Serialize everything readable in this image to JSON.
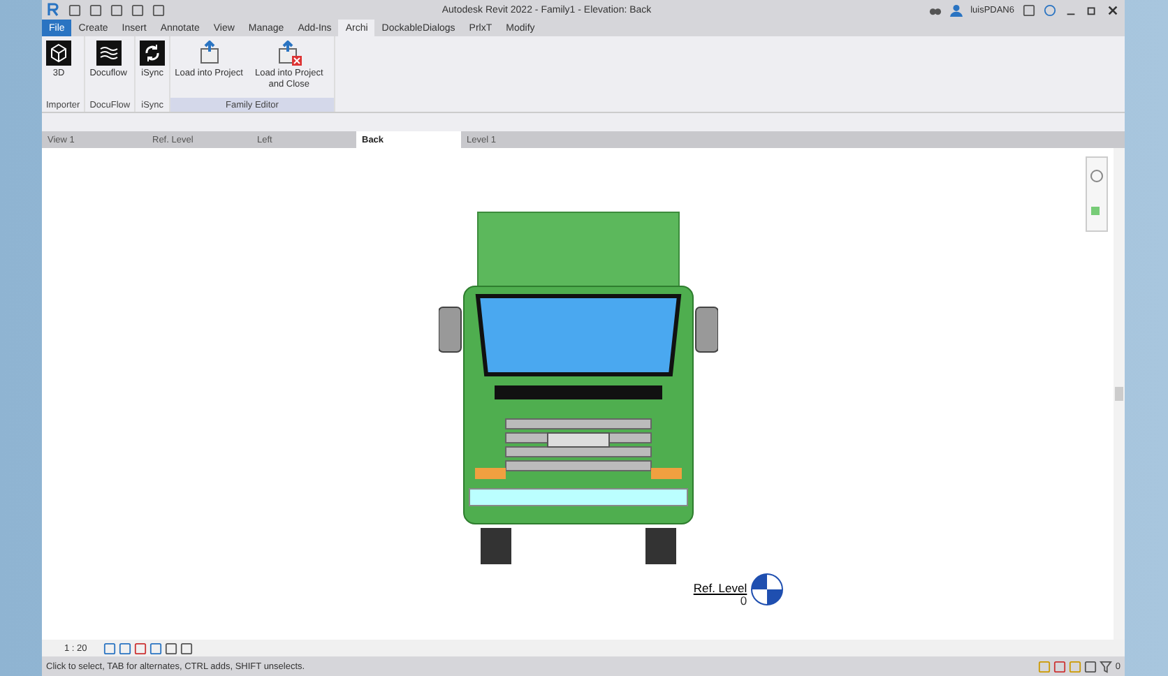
{
  "window": {
    "title": "Autodesk Revit 2022 - Family1 - Elevation: Back",
    "user": "luisPDAN6"
  },
  "ribbon_tabs": [
    {
      "label": "File",
      "kind": "file",
      "selected": false
    },
    {
      "label": "Create",
      "kind": "tab",
      "selected": false
    },
    {
      "label": "Insert",
      "kind": "tab",
      "selected": false
    },
    {
      "label": "Annotate",
      "kind": "tab",
      "selected": false
    },
    {
      "label": "View",
      "kind": "tab",
      "selected": false
    },
    {
      "label": "Manage",
      "kind": "tab",
      "selected": false
    },
    {
      "label": "Add-Ins",
      "kind": "tab",
      "selected": false
    },
    {
      "label": "Archi",
      "kind": "tab",
      "selected": true
    },
    {
      "label": "DockableDialogs",
      "kind": "tab",
      "selected": false
    },
    {
      "label": "PrlxT",
      "kind": "tab",
      "selected": false
    },
    {
      "label": "Modify",
      "kind": "tab",
      "selected": false
    }
  ],
  "panels": [
    {
      "title": "Importer",
      "highlighted": false,
      "buttons": [
        {
          "label": "3D",
          "kind": "cube"
        }
      ]
    },
    {
      "title": "DocuFlow",
      "highlighted": false,
      "buttons": [
        {
          "label": "Docuflow",
          "kind": "waves"
        }
      ]
    },
    {
      "title": "iSync",
      "highlighted": false,
      "buttons": [
        {
          "label": "iSync",
          "kind": "sync"
        }
      ]
    },
    {
      "title": "Family Editor",
      "highlighted": true,
      "buttons": [
        {
          "label": "Load into Project",
          "kind": "load"
        },
        {
          "label": "Load into Project and Close",
          "kind": "loadclose"
        }
      ]
    }
  ],
  "view_tabs": [
    {
      "label": "View 1",
      "selected": false
    },
    {
      "label": "Ref. Level",
      "selected": false
    },
    {
      "label": "Left",
      "selected": false
    },
    {
      "label": "Back",
      "selected": true
    },
    {
      "label": "Level 1",
      "selected": false
    }
  ],
  "level": {
    "name": "Ref. Level",
    "elevation": "0"
  },
  "view_control_bar": {
    "scale": "1 : 20"
  },
  "status_bar": {
    "text": "Click to select, TAB for alternates, CTRL adds, SHIFT unselects.",
    "filter_count": "0"
  }
}
